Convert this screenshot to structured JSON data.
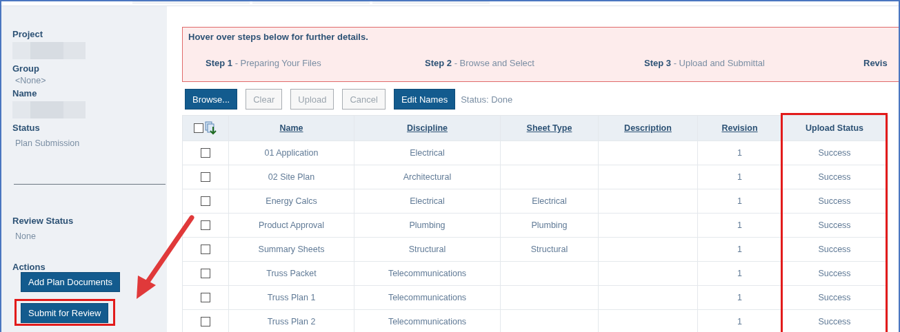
{
  "sidebar": {
    "fields": [
      {
        "label": "Project",
        "redacted": true
      },
      {
        "label": "Group",
        "value": "<None>"
      },
      {
        "label": "Name",
        "redacted": true
      },
      {
        "label": "Status",
        "value": "Plan Submission"
      }
    ],
    "review": {
      "label": "Review Status",
      "value": "None"
    },
    "actions": {
      "label": "Actions",
      "buttons": [
        {
          "label": "Add Plan Documents",
          "highlighted": false
        },
        {
          "label": "Submit for Review",
          "highlighted": true
        }
      ]
    }
  },
  "steps": {
    "hint": "Hover over steps below for further details.",
    "items": [
      "**Step 1** - Preparing Your Files",
      "**Step 2** - Browse and Select",
      "**Step 3** - Upload and Submittal",
      "**Revis**"
    ]
  },
  "toolbar": {
    "buttons": [
      {
        "label": "Browse...",
        "disabled": false
      },
      {
        "label": "Clear",
        "disabled": true
      },
      {
        "label": "Upload",
        "disabled": true
      },
      {
        "label": "Cancel",
        "disabled": true
      },
      {
        "label": "Edit Names",
        "disabled": false
      }
    ],
    "status": "Status: Done"
  },
  "table": {
    "select_all_checked": false,
    "columns": [
      {
        "label": "Name",
        "link": true,
        "highlighted": false
      },
      {
        "label": "Discipline",
        "link": true,
        "highlighted": false
      },
      {
        "label": "Sheet Type",
        "link": true,
        "highlighted": false
      },
      {
        "label": "Description",
        "link": true,
        "highlighted": false
      },
      {
        "label": "Revision",
        "link": true,
        "highlighted": false
      },
      {
        "label": "Upload Status",
        "link": false,
        "highlighted": true
      }
    ],
    "rows": [
      {
        "checked": false,
        "cells": [
          "01 Application",
          "Electrical",
          "",
          "",
          "1",
          "Success"
        ]
      },
      {
        "checked": false,
        "cells": [
          "02 Site Plan",
          "Architectural",
          "",
          "",
          "1",
          "Success"
        ]
      },
      {
        "checked": false,
        "cells": [
          "Energy Calcs",
          "Electrical",
          "Electrical",
          "",
          "1",
          "Success"
        ]
      },
      {
        "checked": false,
        "cells": [
          "Product Approval",
          "Plumbing",
          "Plumbing",
          "",
          "1",
          "Success"
        ]
      },
      {
        "checked": false,
        "cells": [
          "Summary Sheets",
          "Structural",
          "Structural",
          "",
          "1",
          "Success"
        ]
      },
      {
        "checked": false,
        "cells": [
          "Truss Packet",
          "Telecommunications",
          "",
          "",
          "1",
          "Success"
        ]
      },
      {
        "checked": false,
        "cells": [
          "Truss Plan 1",
          "Telecommunications",
          "",
          "",
          "1",
          "Success"
        ]
      },
      {
        "checked": false,
        "cells": [
          "Truss Plan 2",
          "Telecommunications",
          "",
          "",
          "1",
          "Success"
        ]
      }
    ]
  }
}
